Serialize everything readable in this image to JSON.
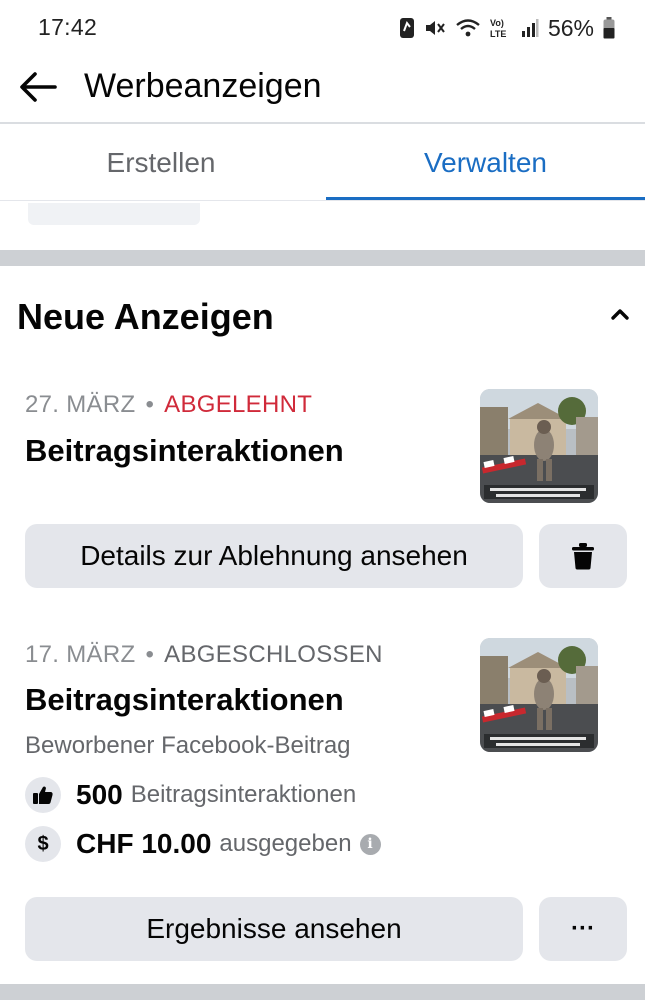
{
  "status_bar": {
    "time": "17:42",
    "battery": "56%",
    "icons": [
      "nfc-icon",
      "mute-icon",
      "wifi-icon",
      "volte-icon",
      "signal-icon",
      "battery-icon"
    ]
  },
  "header": {
    "title": "Werbeanzeigen",
    "back_icon": "back-arrow-icon"
  },
  "tabs": [
    {
      "label": "Erstellen",
      "active": false
    },
    {
      "label": "Verwalten",
      "active": true
    }
  ],
  "section": {
    "title": "Neue Anzeigen"
  },
  "ads": [
    {
      "date": "27. MÄRZ",
      "status": "ABGELEHNT",
      "title": "Beitragsinteraktionen",
      "primary_button": "Details zur Ablehnung ansehen",
      "secondary_icon": "trash-icon"
    },
    {
      "date": "17. MÄRZ",
      "status": "ABGESCHLOSSEN",
      "title": "Beitragsinteraktionen",
      "subtitle": "Beworbener Facebook-Beitrag",
      "metrics": [
        {
          "icon": "thumbs-up-icon",
          "value": "500",
          "label": "Beitragsinteraktionen"
        },
        {
          "icon": "dollar-icon",
          "value": "CHF 10.00",
          "label": "ausgegeben"
        }
      ],
      "primary_button": "Ergebnisse ansehen",
      "secondary_icon": "more-icon",
      "secondary_label": "···"
    }
  ],
  "colors": {
    "accent": "#1a6dc3",
    "rejected": "#d02a3a",
    "button_bg": "#e4e6eb",
    "separator": "#cdd0d4"
  }
}
